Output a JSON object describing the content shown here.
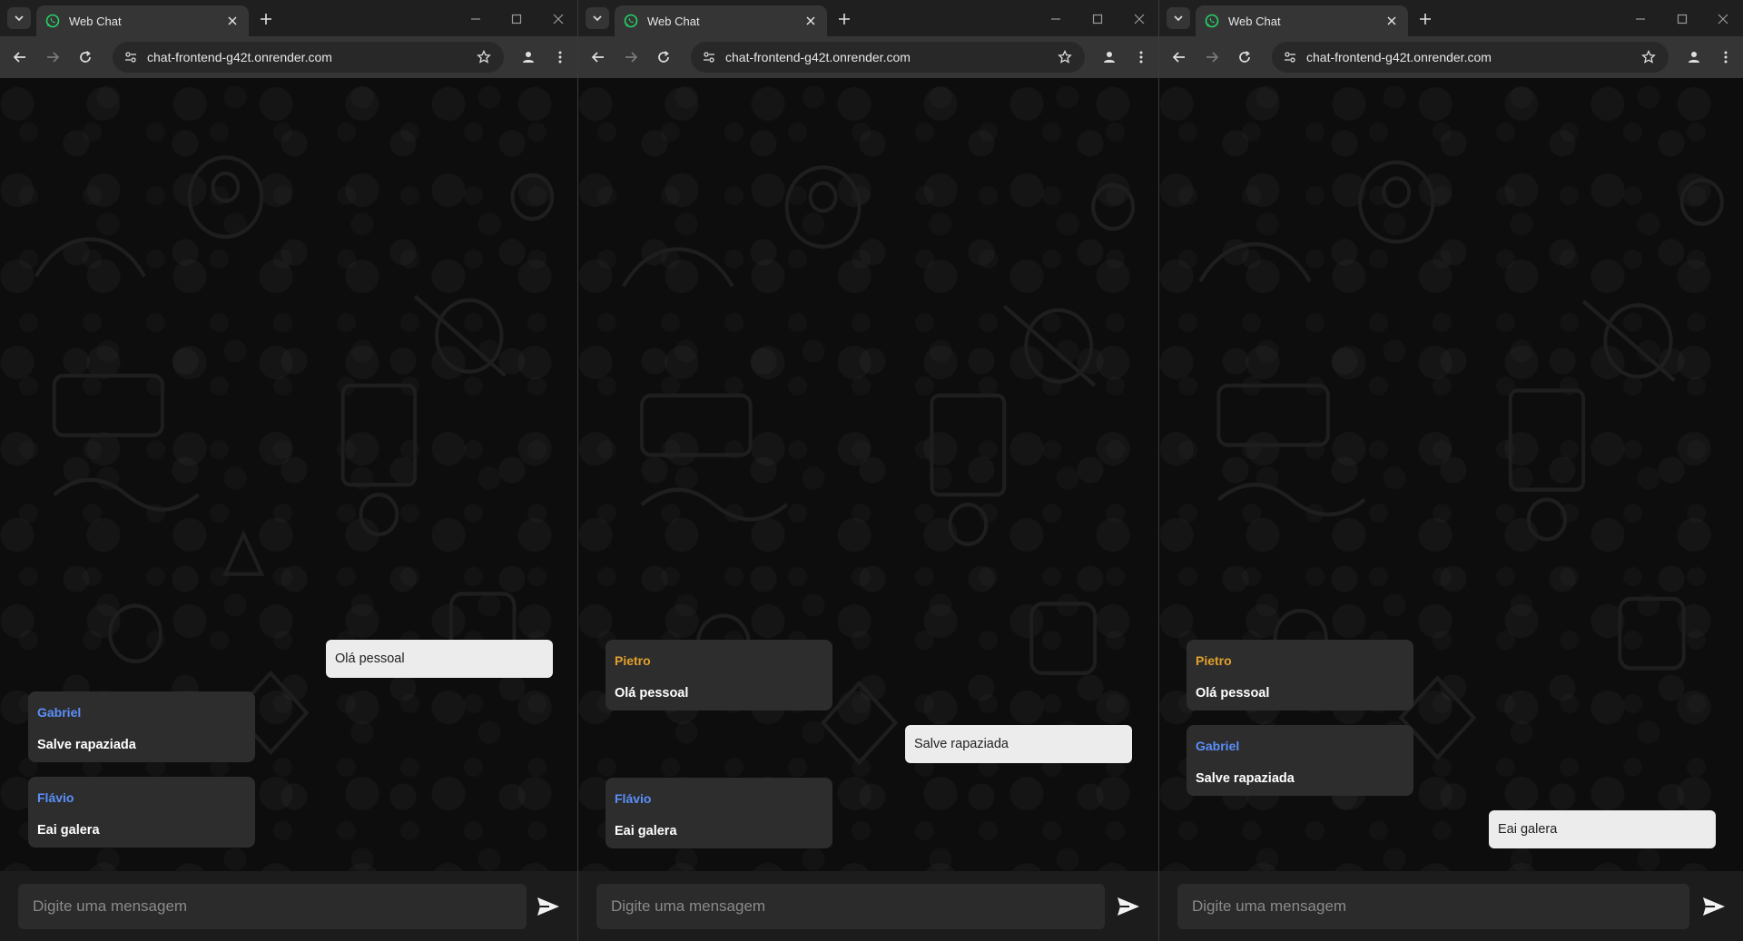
{
  "colors": {
    "sender_pietro": "#e2a12b",
    "sender_blue": "#5b8ff9",
    "own_bubble": "#ececec",
    "other_bubble": "#2d2d2d"
  },
  "windows": [
    {
      "tab_title": "Web Chat",
      "url": "chat-frontend-g42t.onrender.com",
      "composer_placeholder": "Digite uma mensagem",
      "messages": [
        {
          "own": true,
          "sender": "",
          "text": "Olá pessoal"
        },
        {
          "own": false,
          "sender": "Gabriel",
          "sender_color": "#5b8ff9",
          "text": "Salve rapaziada"
        },
        {
          "own": false,
          "sender": "Flávio",
          "sender_color": "#5b8ff9",
          "text": "Eai galera"
        }
      ]
    },
    {
      "tab_title": "Web Chat",
      "url": "chat-frontend-g42t.onrender.com",
      "composer_placeholder": "Digite uma mensagem",
      "messages": [
        {
          "own": false,
          "sender": "Pietro",
          "sender_color": "#e2a12b",
          "text": "Olá pessoal"
        },
        {
          "own": true,
          "sender": "",
          "text": "Salve rapaziada"
        },
        {
          "own": false,
          "sender": "Flávio",
          "sender_color": "#5b8ff9",
          "text": "Eai galera"
        }
      ]
    },
    {
      "tab_title": "Web Chat",
      "url": "chat-frontend-g42t.onrender.com",
      "composer_placeholder": "Digite uma mensagem",
      "messages": [
        {
          "own": false,
          "sender": "Pietro",
          "sender_color": "#e2a12b",
          "text": "Olá pessoal"
        },
        {
          "own": false,
          "sender": "Gabriel",
          "sender_color": "#5b8ff9",
          "text": "Salve rapaziada"
        },
        {
          "own": true,
          "sender": "",
          "text": "Eai galera"
        }
      ]
    }
  ]
}
